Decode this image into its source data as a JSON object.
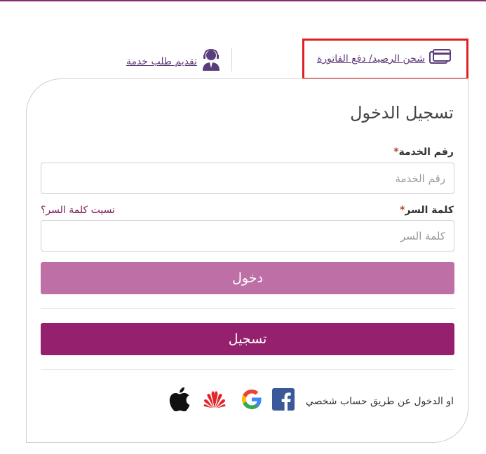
{
  "header": {
    "recharge_link": "شحن الرصيد/ دفع الفاتورة",
    "service_request_link": "تقديم طلب خدمة"
  },
  "login": {
    "title": "تسجيل الدخول",
    "service_label": "رقم الخدمة",
    "service_placeholder": "رقم الخدمة",
    "password_label": "كلمة السر",
    "password_placeholder": "كلمة السر",
    "required_mark": "*",
    "forgot_password": "نسيت كلمة السر؟",
    "login_button": "دخول",
    "register_button": "تسجيل",
    "social_text": "او الدخول عن طريق حساب شخصي"
  },
  "social_icons": [
    "facebook-icon",
    "google-icon",
    "huawei-icon",
    "apple-icon"
  ],
  "colors": {
    "brand": "#95206e",
    "login_button": "#bd6fa6",
    "link": "#5e3a7a",
    "highlight": "#e02020"
  }
}
